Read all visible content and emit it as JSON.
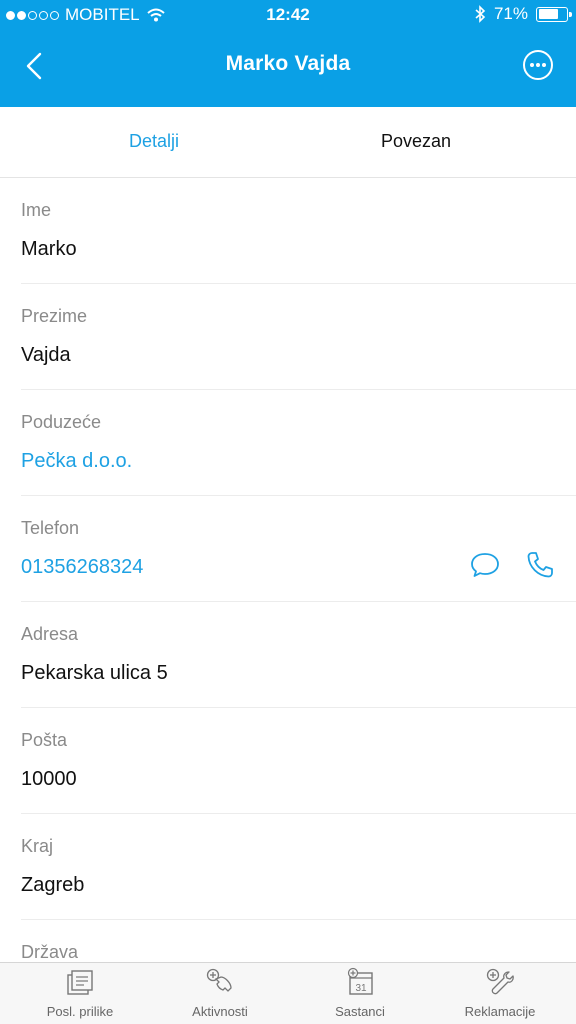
{
  "status_bar": {
    "carrier": "MOBITEL",
    "time": "12:42",
    "battery": "71%",
    "battery_level": 0.71,
    "signal_bars_filled": 2,
    "signal_bars_total": 5
  },
  "nav": {
    "title": "Marko Vajda",
    "back_icon": "chevron-left-icon",
    "more_icon": "more-horizontal-circle-icon"
  },
  "tabs": {
    "details": "Detalji",
    "related": "Povezan",
    "active": "details"
  },
  "fields": [
    {
      "label": "Ime",
      "value": "Marko",
      "link": false
    },
    {
      "label": "Prezime",
      "value": "Vajda",
      "link": false
    },
    {
      "label": "Poduzeće",
      "value": "Pečka d.o.o.",
      "link": true
    },
    {
      "label": "Telefon",
      "value": "01356268324",
      "link": true
    },
    {
      "label": "Adresa",
      "value": "Pekarska ulica 5",
      "link": false
    },
    {
      "label": "Pošta",
      "value": "10000",
      "link": false
    },
    {
      "label": "Kraj",
      "value": "Zagreb",
      "link": false
    },
    {
      "label": "Država",
      "value": "",
      "link": false
    }
  ],
  "bottom_tabs": [
    {
      "label": "Posl. prilike",
      "icon": "opportunities-icon"
    },
    {
      "label": "Aktivnosti",
      "icon": "add-call-icon"
    },
    {
      "label": "Sastanci",
      "icon": "calendar-add-icon",
      "icon_text": "31"
    },
    {
      "label": "Reklamacije",
      "icon": "wrench-add-icon"
    }
  ],
  "colors": {
    "accent": "#0aa0e6",
    "link": "#1ea1e3",
    "label_gray": "#8a8a8a"
  }
}
